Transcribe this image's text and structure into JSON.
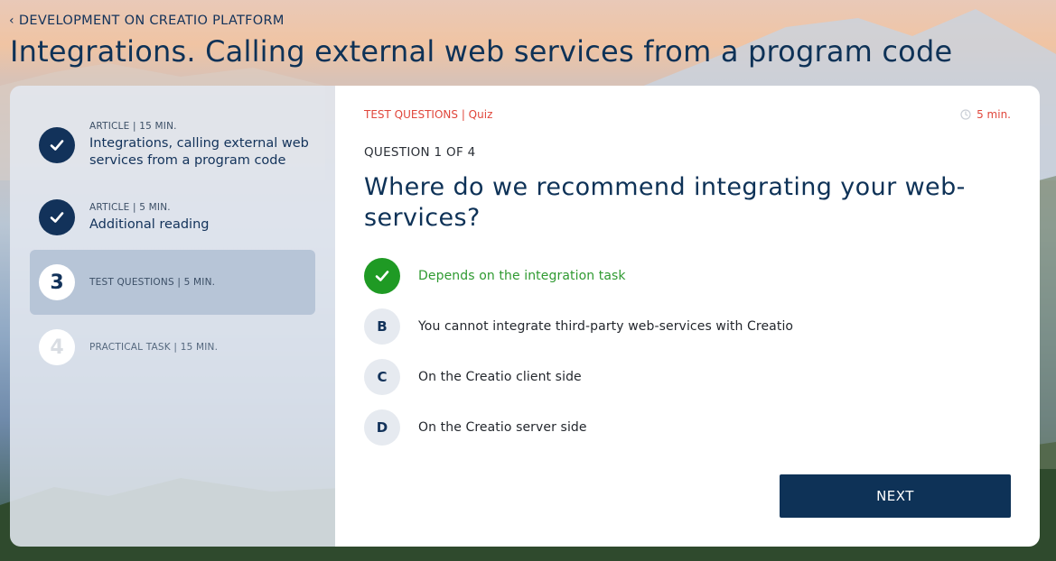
{
  "breadcrumb": {
    "label": "DEVELOPMENT ON CREATIO PLATFORM"
  },
  "page_title": "Integrations. Calling external web services from a program code",
  "sidebar": {
    "steps": [
      {
        "badge": "",
        "state": "done",
        "meta": "ARTICLE | 15 MIN.",
        "name": "Integrations, calling external web services from a program code"
      },
      {
        "badge": "",
        "state": "done",
        "meta": "ARTICLE | 5 MIN.",
        "name": "Additional reading"
      },
      {
        "badge": "3",
        "state": "current",
        "meta": "TEST QUESTIONS | 5 MIN.",
        "name": ""
      },
      {
        "badge": "4",
        "state": "future",
        "meta": "PRACTICAL TASK | 15 MIN.",
        "name": ""
      }
    ]
  },
  "quiz": {
    "tag": "TEST QUESTIONS | Quiz",
    "timer": "5 min.",
    "counter": "QUESTION 1 OF 4",
    "question": "Where do we recommend integrating your web-services?",
    "options": [
      {
        "letter": "",
        "state": "correct",
        "label": "Depends on the integration task"
      },
      {
        "letter": "B",
        "state": "default",
        "label": "You cannot integrate third-party web-services with Creatio"
      },
      {
        "letter": "C",
        "state": "default",
        "label": "On the Creatio client side"
      },
      {
        "letter": "D",
        "state": "default",
        "label": "On the Creatio server side"
      }
    ],
    "next_label": "NEXT"
  },
  "colors": {
    "navy": "#0e3257",
    "accent_red": "#e0463b",
    "correct_green": "#1f9a24"
  }
}
